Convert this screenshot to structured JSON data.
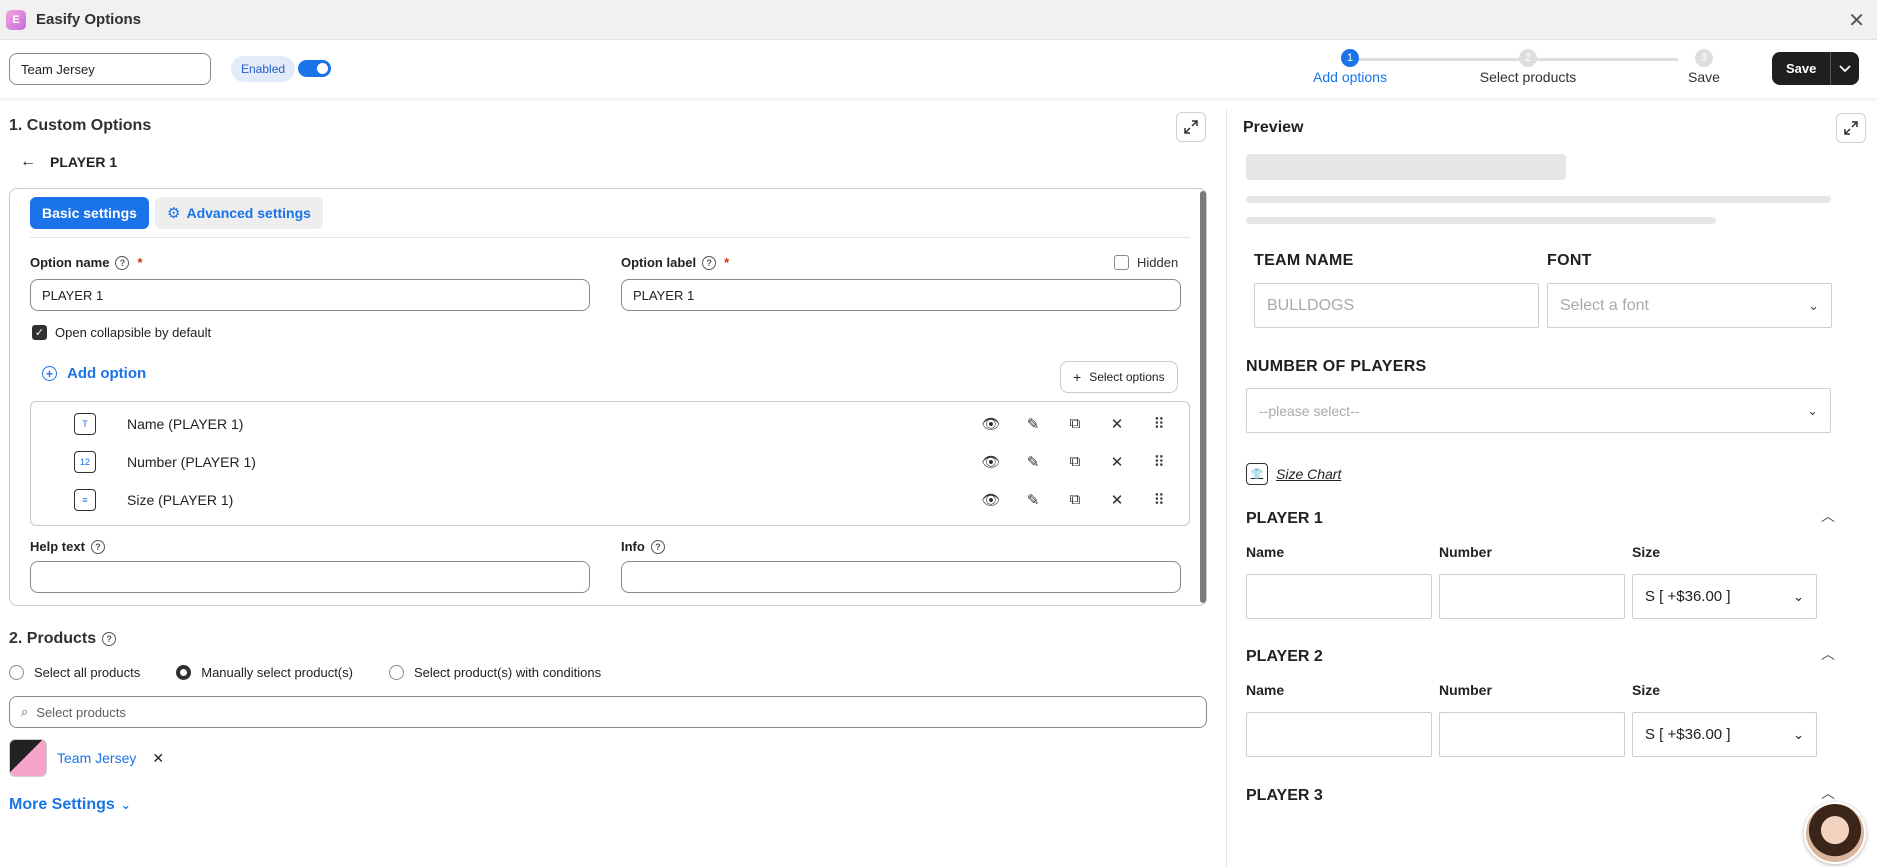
{
  "app": {
    "title": "Easify Options",
    "icon_text": "E"
  },
  "topbar": {
    "option_set_name": "Team Jersey",
    "status_badge": "Enabled",
    "enabled": true,
    "steps": [
      {
        "number": "1",
        "label": "Add options",
        "active": true
      },
      {
        "number": "2",
        "label": "Select products",
        "active": false
      },
      {
        "number": "3",
        "label": "Save",
        "active": false
      }
    ],
    "save_label": "Save"
  },
  "custom_options": {
    "section_title": "1. Custom Options",
    "back_label": "PLAYER 1",
    "tabs": {
      "basic": "Basic settings",
      "advanced": "Advanced settings"
    },
    "option_name_label": "Option name",
    "option_name_value": "PLAYER 1",
    "option_label_label": "Option label",
    "option_label_value": "PLAYER 1",
    "hidden_label": "Hidden",
    "open_collapsible_label": "Open collapsible by default",
    "open_collapsible_checked": true,
    "add_option_label": "Add option",
    "select_options_label": "Select options",
    "options": [
      {
        "name": "Name (PLAYER 1)",
        "icon": "text-field-icon",
        "glyph": "T"
      },
      {
        "name": "Number (PLAYER 1)",
        "icon": "number-field-icon",
        "glyph": "12"
      },
      {
        "name": "Size (PLAYER 1)",
        "icon": "dropdown-field-icon",
        "glyph": "≡"
      }
    ],
    "help_text_label": "Help text",
    "help_text_value": "",
    "info_label": "Info",
    "info_value": ""
  },
  "products": {
    "section_title": "2. Products",
    "radio_options": [
      {
        "label": "Select all products",
        "selected": false
      },
      {
        "label": "Manually select product(s)",
        "selected": true
      },
      {
        "label": "Select product(s) with conditions",
        "selected": false
      }
    ],
    "search_placeholder": "Select products",
    "selected_products": [
      {
        "name": "Team Jersey"
      }
    ],
    "more_settings_label": "More Settings"
  },
  "preview": {
    "title": "Preview",
    "team_name_label": "TEAM NAME",
    "team_name_placeholder": "BULLDOGS",
    "font_label": "FONT",
    "font_placeholder": "Select a font",
    "num_players_label": "NUMBER OF PLAYERS",
    "num_players_placeholder": "--please select--",
    "size_chart_label": "Size Chart",
    "players": [
      {
        "title": "PLAYER 1",
        "name_col": "Name",
        "number_col": "Number",
        "size_col": "Size",
        "size_value": "S [ +$36.00 ]"
      },
      {
        "title": "PLAYER 2",
        "name_col": "Name",
        "number_col": "Number",
        "size_col": "Size",
        "size_value": "S [ +$36.00 ]"
      },
      {
        "title": "PLAYER 3"
      }
    ]
  },
  "colors": {
    "accent": "#1a73e8",
    "save_bg": "#1f1f1f",
    "required": "#d72c0d"
  }
}
